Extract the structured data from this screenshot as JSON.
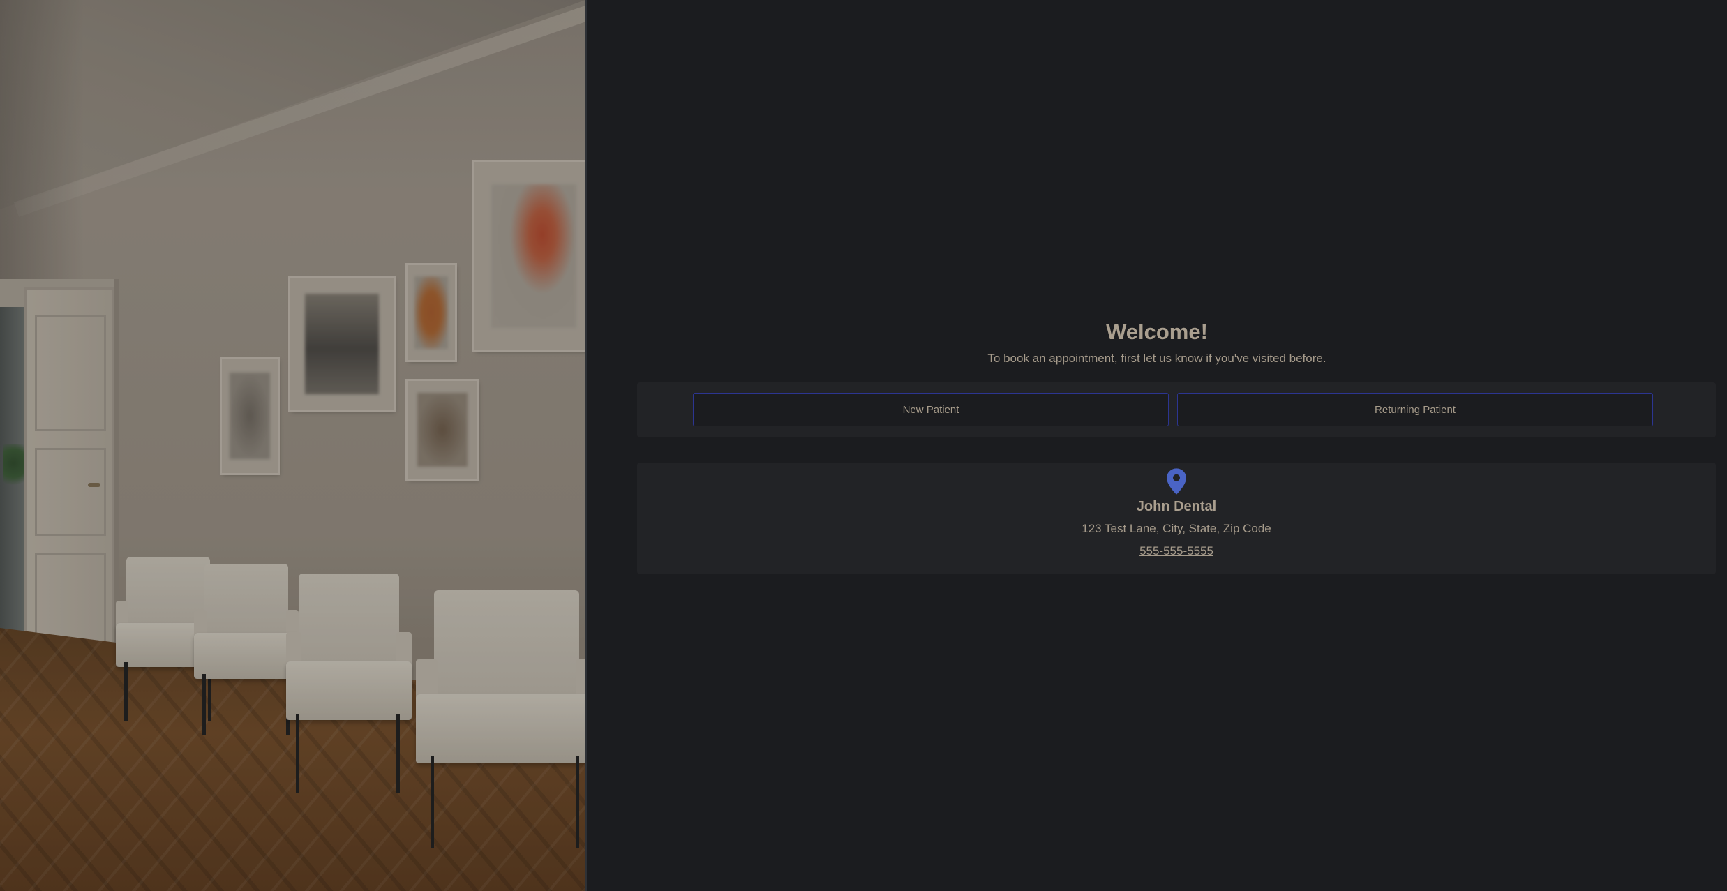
{
  "welcome": {
    "title": "Welcome!",
    "subtitle": "To book an appointment, first let us know if you've visited before."
  },
  "patient_type": {
    "new_label": "New Patient",
    "returning_label": "Returning Patient"
  },
  "location": {
    "icon": "map-pin-icon",
    "name": "John Dental",
    "address": "123 Test Lane, City, State, Zip Code",
    "phone": "555-555-5555"
  },
  "colors": {
    "background": "#1b1c1f",
    "card": "#222326",
    "text": "#a69b8b",
    "button_border": "#2c3591",
    "pin": "#4a64c5"
  }
}
